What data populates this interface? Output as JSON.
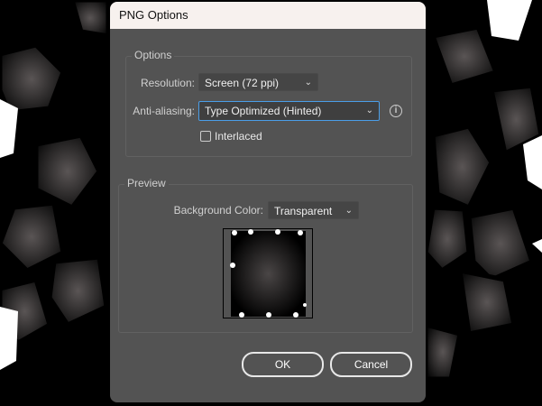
{
  "dialog": {
    "title": "PNG Options"
  },
  "options": {
    "legend": "Options",
    "resolution_label": "Resolution:",
    "resolution_value": "Screen (72 ppi)",
    "antialias_label": "Anti-aliasing:",
    "antialias_value": "Type Optimized (Hinted)",
    "interlaced_label": "Interlaced",
    "interlaced_checked": false
  },
  "preview": {
    "legend": "Preview",
    "bg_label": "Background Color:",
    "bg_value": "Transparent"
  },
  "buttons": {
    "ok": "OK",
    "cancel": "Cancel"
  },
  "icons": {
    "chevron": "⌄",
    "info": "i"
  }
}
